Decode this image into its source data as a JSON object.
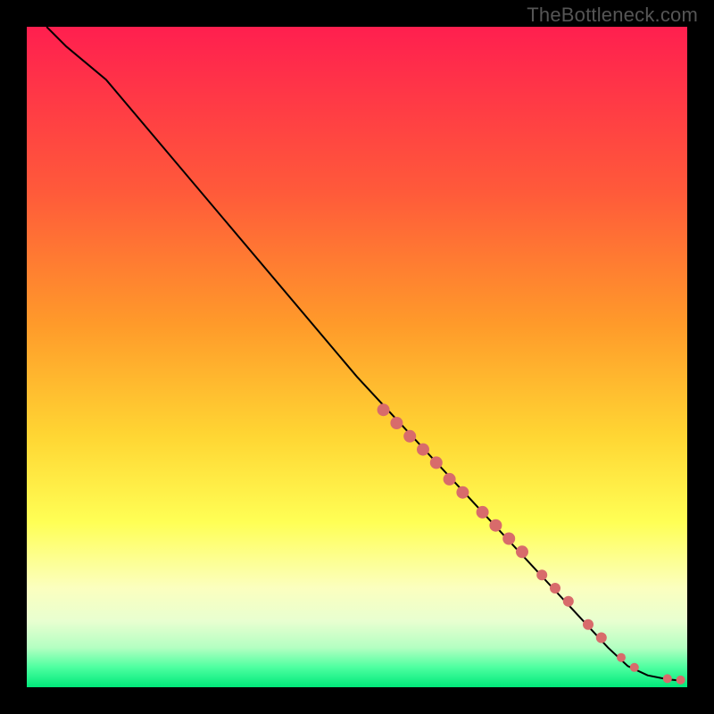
{
  "watermark": "TheBottleneck.com",
  "colors": {
    "background": "#000000",
    "dot": "#d86b6b",
    "curve": "#000000"
  },
  "chart_data": {
    "type": "line",
    "title": "",
    "xlabel": "",
    "ylabel": "",
    "xlim": [
      0,
      100
    ],
    "ylim": [
      0,
      100
    ],
    "gradient_stops": [
      {
        "offset": 0,
        "color": "#ff1f4f"
      },
      {
        "offset": 25,
        "color": "#ff5a3a"
      },
      {
        "offset": 45,
        "color": "#ff9a2a"
      },
      {
        "offset": 62,
        "color": "#ffd633"
      },
      {
        "offset": 75,
        "color": "#ffff55"
      },
      {
        "offset": 85,
        "color": "#fbffbf"
      },
      {
        "offset": 90,
        "color": "#e8ffd0"
      },
      {
        "offset": 94,
        "color": "#b4ffc2"
      },
      {
        "offset": 97,
        "color": "#4dffa0"
      },
      {
        "offset": 100,
        "color": "#00e87a"
      }
    ],
    "curve_points": [
      {
        "x": 3,
        "y": 100
      },
      {
        "x": 6,
        "y": 97
      },
      {
        "x": 9,
        "y": 94.5
      },
      {
        "x": 12,
        "y": 92
      },
      {
        "x": 50,
        "y": 47
      },
      {
        "x": 88,
        "y": 6
      },
      {
        "x": 91,
        "y": 3.2
      },
      {
        "x": 94,
        "y": 1.8
      },
      {
        "x": 97,
        "y": 1.2
      },
      {
        "x": 99,
        "y": 1.0
      }
    ],
    "dots": [
      {
        "x": 54,
        "y": 42,
        "r": 7
      },
      {
        "x": 56,
        "y": 40,
        "r": 7
      },
      {
        "x": 58,
        "y": 38,
        "r": 7
      },
      {
        "x": 60,
        "y": 36,
        "r": 7
      },
      {
        "x": 62,
        "y": 34,
        "r": 7
      },
      {
        "x": 64,
        "y": 31.5,
        "r": 7
      },
      {
        "x": 66,
        "y": 29.5,
        "r": 7
      },
      {
        "x": 69,
        "y": 26.5,
        "r": 7
      },
      {
        "x": 71,
        "y": 24.5,
        "r": 7
      },
      {
        "x": 73,
        "y": 22.5,
        "r": 7
      },
      {
        "x": 75,
        "y": 20.5,
        "r": 7
      },
      {
        "x": 78,
        "y": 17,
        "r": 6
      },
      {
        "x": 80,
        "y": 15,
        "r": 6
      },
      {
        "x": 82,
        "y": 13,
        "r": 6
      },
      {
        "x": 85,
        "y": 9.5,
        "r": 6
      },
      {
        "x": 87,
        "y": 7.5,
        "r": 6
      },
      {
        "x": 90,
        "y": 4.5,
        "r": 5
      },
      {
        "x": 92,
        "y": 3,
        "r": 5
      },
      {
        "x": 97,
        "y": 1.3,
        "r": 5
      },
      {
        "x": 99,
        "y": 1.1,
        "r": 5
      }
    ]
  }
}
